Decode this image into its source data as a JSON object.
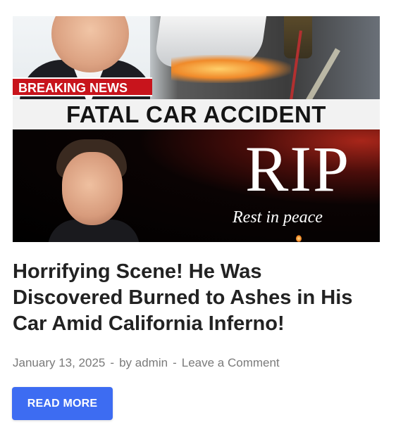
{
  "post": {
    "image": {
      "banner": "BREAKING NEWS",
      "headline": "FATAL CAR ACCIDENT",
      "rip": "RIP",
      "caption": "Rest in peace"
    },
    "title": "Horrifying Scene! He Was Discovered Burned to Ashes in His Car Amid California Inferno!",
    "meta": {
      "date": "January 13, 2025",
      "separator": "-",
      "author_prefix": "by",
      "author": "admin",
      "comments": "Leave a Comment"
    },
    "read_more_label": "READ MORE"
  },
  "colors": {
    "button": "#3d6cf2",
    "title": "#222222",
    "meta": "#7a7a7a",
    "banner": "#c8141c"
  }
}
